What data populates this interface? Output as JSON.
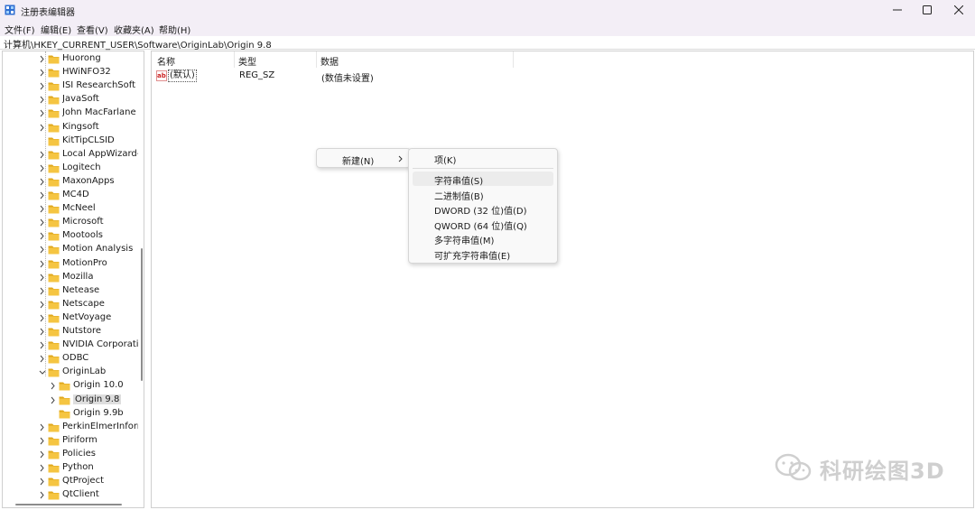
{
  "window": {
    "title": "注册表编辑器",
    "minimize_icon": "minimize-icon",
    "maximize_icon": "maximize-icon",
    "close_icon": "close-icon"
  },
  "menubar": [
    "文件(F)",
    "编辑(E)",
    "查看(V)",
    "收藏夹(A)",
    "帮助(H)"
  ],
  "address": "计算机\\HKEY_CURRENT_USER\\Software\\OriginLab\\Origin 9.8",
  "tree": {
    "items": [
      {
        "label": "Huorong",
        "level": 0,
        "expanded": false
      },
      {
        "label": "HWiNFO32",
        "level": 0,
        "expanded": false
      },
      {
        "label": "ISI ResearchSoft",
        "level": 0,
        "expanded": false
      },
      {
        "label": "JavaSoft",
        "level": 0,
        "expanded": false
      },
      {
        "label": "John MacFarlane",
        "level": 0,
        "expanded": false
      },
      {
        "label": "Kingsoft",
        "level": 0,
        "expanded": false
      },
      {
        "label": "KitTipCLSID",
        "level": 0,
        "expanded": false,
        "leaf": true
      },
      {
        "label": "Local AppWizard-Generated",
        "level": 0,
        "expanded": false
      },
      {
        "label": "Logitech",
        "level": 0,
        "expanded": false
      },
      {
        "label": "MaxonApps",
        "level": 0,
        "expanded": false
      },
      {
        "label": "MC4D",
        "level": 0,
        "expanded": false
      },
      {
        "label": "McNeel",
        "level": 0,
        "expanded": false
      },
      {
        "label": "Microsoft",
        "level": 0,
        "expanded": false
      },
      {
        "label": "Mootools",
        "level": 0,
        "expanded": false
      },
      {
        "label": "Motion Analysis",
        "level": 0,
        "expanded": false
      },
      {
        "label": "MotionPro",
        "level": 0,
        "expanded": false
      },
      {
        "label": "Mozilla",
        "level": 0,
        "expanded": false
      },
      {
        "label": "Netease",
        "level": 0,
        "expanded": false
      },
      {
        "label": "Netscape",
        "level": 0,
        "expanded": false
      },
      {
        "label": "NetVoyage",
        "level": 0,
        "expanded": false
      },
      {
        "label": "Nutstore",
        "level": 0,
        "expanded": false
      },
      {
        "label": "NVIDIA Corporation",
        "level": 0,
        "expanded": false
      },
      {
        "label": "ODBC",
        "level": 0,
        "expanded": false
      },
      {
        "label": "OriginLab",
        "level": 0,
        "expanded": true
      },
      {
        "label": "Origin 10.0",
        "level": 1,
        "expanded": false
      },
      {
        "label": "Origin 9.8",
        "level": 1,
        "expanded": false,
        "selected": true
      },
      {
        "label": "Origin 9.9b",
        "level": 1,
        "expanded": false,
        "leaf": true
      },
      {
        "label": "PerkinElmerInformatics",
        "level": 0,
        "expanded": false
      },
      {
        "label": "Piriform",
        "level": 0,
        "expanded": false
      },
      {
        "label": "Policies",
        "level": 0,
        "expanded": false
      },
      {
        "label": "Python",
        "level": 0,
        "expanded": false
      },
      {
        "label": "QtProject",
        "level": 0,
        "expanded": false
      },
      {
        "label": "QtClient",
        "level": 0,
        "expanded": false
      }
    ]
  },
  "values": {
    "headers": {
      "name": "名称",
      "type": "类型",
      "data": "数据"
    },
    "rows": [
      {
        "icon": "ab-string-icon",
        "name": "(默认)",
        "type": "REG_SZ",
        "data": "(数值未设置)"
      }
    ]
  },
  "context_menu": {
    "new_label": "新建(N)",
    "submenu": {
      "key_label": "项(K)",
      "items": [
        {
          "label": "字符串值(S)",
          "hover": true
        },
        {
          "label": "二进制值(B)"
        },
        {
          "label": "DWORD (32 位)值(D)"
        },
        {
          "label": "QWORD (64 位)值(Q)"
        },
        {
          "label": "多字符串值(M)"
        },
        {
          "label": "可扩充字符串值(E)"
        }
      ]
    }
  },
  "watermark": {
    "text": "科研绘图3D",
    "icon": "wechat-icon"
  },
  "colors": {
    "titlebar_bg": "#f3eef6",
    "folder": "#f5c542",
    "folder_dark": "#e0a81c",
    "selection": "#dedede"
  }
}
